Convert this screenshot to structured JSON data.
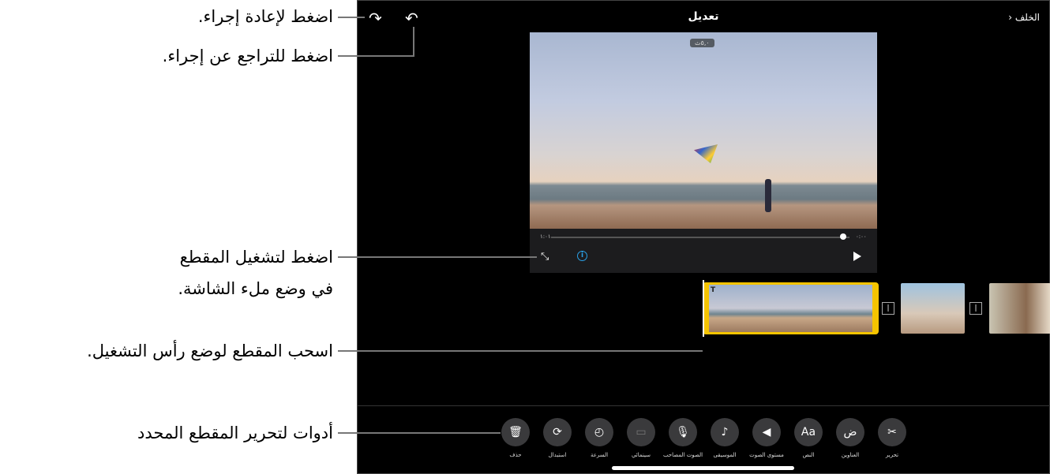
{
  "callouts": {
    "redo": "اضغط لإعادة إجراء.",
    "undo": "اضغط للتراجع عن إجراء.",
    "fullscreen_line1": "اضغط لتشغيل المقطع",
    "fullscreen_line2": "في وضع ملء الشاشة.",
    "playhead": "اسحب المقطع لوضع رأس التشغيل.",
    "tools": "أدوات لتحرير المقطع المحدد"
  },
  "header": {
    "back": "الخلف",
    "title": "تعديل"
  },
  "viewer": {
    "duration_badge": "٥,٠ث",
    "time_current": "١:٠١",
    "time_end": "٠:٠٠",
    "progress": 0.98
  },
  "tools": [
    {
      "label": "حذف",
      "icon": "trash-icon"
    },
    {
      "label": "استبدال",
      "icon": "replace-icon"
    },
    {
      "label": "السرعة",
      "icon": "speed-icon"
    },
    {
      "label": "سينمائي",
      "icon": "cinematic-icon"
    },
    {
      "label": "الصوت المصاحب",
      "icon": "microphone-icon"
    },
    {
      "label": "الموسيقى",
      "icon": "music-icon"
    },
    {
      "label": "مستوى الصوت",
      "icon": "volume-icon"
    },
    {
      "label": "النص",
      "icon": "text-icon",
      "glyph": "Aa"
    },
    {
      "label": "العناوين",
      "icon": "titles-icon"
    },
    {
      "label": "تحرير",
      "icon": "scissors-icon"
    }
  ]
}
